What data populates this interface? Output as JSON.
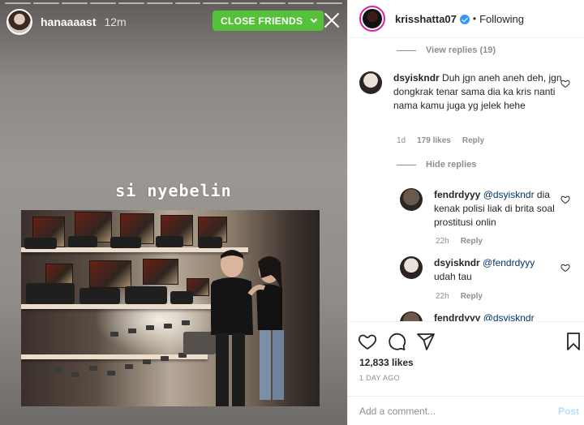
{
  "story": {
    "username": "hanaaaast",
    "time": "12m",
    "badge": "CLOSE FRIENDS",
    "caption": "si nyebelin",
    "progress_segments": 12
  },
  "post": {
    "username": "krisshatta07",
    "verified": true,
    "follow_state": "Following",
    "separator": "•",
    "likes": "12,833 likes",
    "date": "1 DAY AGO"
  },
  "comments": {
    "view_replies": "View replies (19)",
    "hide_replies": "Hide replies",
    "main": {
      "user": "dsyiskndr",
      "text": "Duh jgn aneh aneh deh, jgn dongkrak tenar sama dia ka kris nanti nama kamu juga yg jelek hehe",
      "age": "1d",
      "likes": "179 likes",
      "reply": "Reply"
    },
    "replies": [
      {
        "user": "fendrdyyy",
        "mention": "@dsyiskndr",
        "text": "dia kenak polisi liak di brita soal prostitusi onlin",
        "age": "22h",
        "reply": "Reply"
      },
      {
        "user": "dsyiskndr",
        "mention": "@fendrdyyy",
        "text": "udah tau",
        "age": "22h",
        "reply": "Reply"
      },
      {
        "user": "fendrdyyy",
        "mention": "@dsyiskndr",
        "text": "",
        "age": "",
        "reply": ""
      }
    ]
  },
  "composer": {
    "placeholder": "Add a comment...",
    "post_label": "Post"
  },
  "icons": {
    "like": "heart-icon",
    "comment": "comment-icon",
    "share": "paper-plane-icon",
    "save": "bookmark-icon",
    "close": "close-icon",
    "badge_chevron": "chevron-down-icon",
    "verified": "verified-badge-icon"
  },
  "colors": {
    "close_friends_green": "#55c13a",
    "verified_blue": "#3897f0",
    "mention": "#003569",
    "muted": "#8e8e8e",
    "post_disabled": "#b2dffc"
  }
}
